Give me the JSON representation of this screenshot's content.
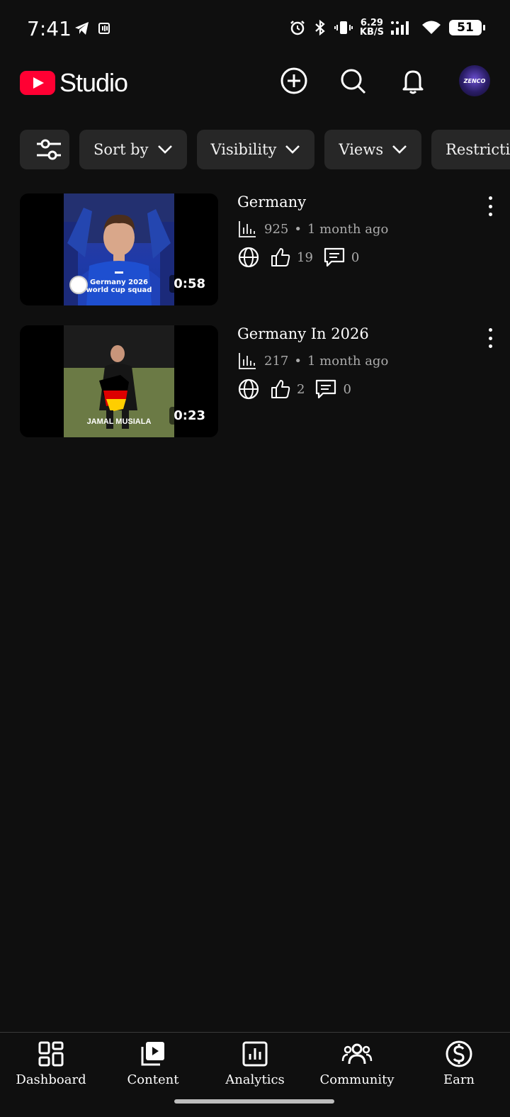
{
  "status_bar": {
    "time": "7:41",
    "speed_top": "6.29",
    "speed_bottom": "KB/S",
    "battery": "51",
    "icons": [
      "telegram-icon",
      "nfc-icon",
      "alarm-icon",
      "bluetooth-icon",
      "vibrate-icon",
      "signal-icon",
      "wifi-icon",
      "battery-icon"
    ]
  },
  "header": {
    "logo_text": "Studio",
    "avatar_text": "ZENCO",
    "brand_color": "#ff0033"
  },
  "filters": {
    "chips": [
      {
        "label": "Sort by"
      },
      {
        "label": "Visibility"
      },
      {
        "label": "Views"
      },
      {
        "label": "Restrictions"
      }
    ]
  },
  "videos": [
    {
      "title": "Germany",
      "views": "925",
      "age": "1 month ago",
      "likes": "19",
      "comments": "0",
      "duration": "0:58",
      "thumb_caption_1": "Germany 2026",
      "thumb_caption_2": "world cup squad"
    },
    {
      "title": "Germany In 2026",
      "views": "217",
      "age": "1 month ago",
      "likes": "2",
      "comments": "0",
      "duration": "0:23",
      "thumb_caption": "JAMAL MUSIALA"
    }
  ],
  "nav": {
    "items": [
      {
        "label": "Dashboard",
        "icon": "dashboard-icon"
      },
      {
        "label": "Content",
        "icon": "content-icon"
      },
      {
        "label": "Analytics",
        "icon": "analytics-icon"
      },
      {
        "label": "Community",
        "icon": "community-icon"
      },
      {
        "label": "Earn",
        "icon": "earn-icon"
      }
    ]
  }
}
